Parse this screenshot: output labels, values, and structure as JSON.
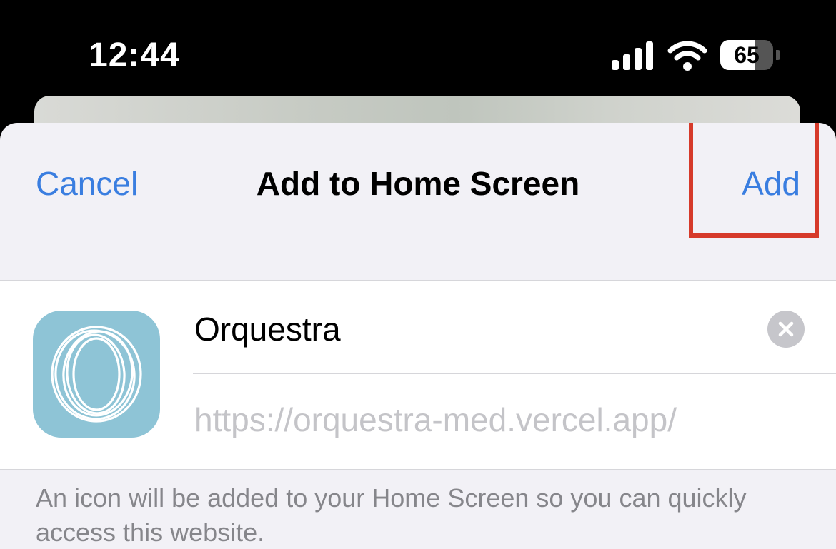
{
  "status_bar": {
    "time": "12:44",
    "battery_percent": "65",
    "battery_level": 0.65
  },
  "sheet": {
    "title": "Add to Home Screen",
    "cancel_label": "Cancel",
    "add_label": "Add",
    "accent_color": "#3a7ee0",
    "highlight_color": "#d63a2a"
  },
  "form": {
    "name_value": "Orquestra",
    "url": "https://orquestra-med.vercel.app/",
    "icon_color": "#8ec4d6"
  },
  "footer": {
    "text": "An icon will be added to your Home Screen so you can quickly access this website."
  }
}
